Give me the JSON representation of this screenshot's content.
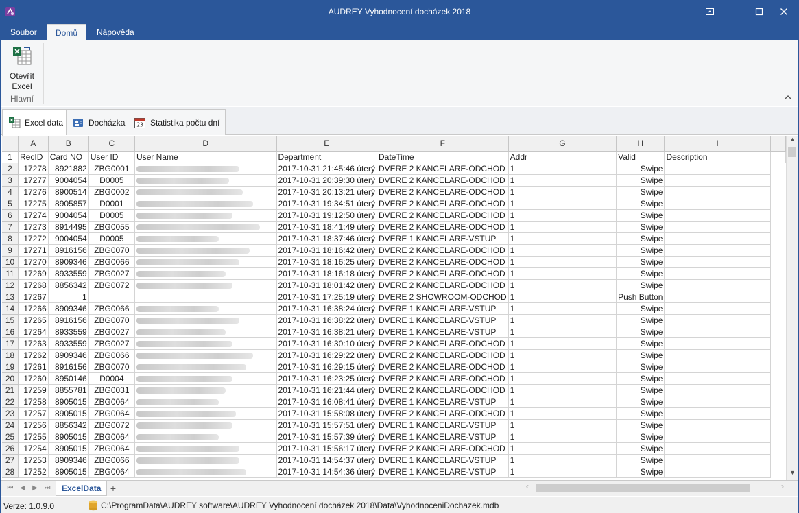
{
  "window": {
    "title": "AUDREY Vyhodnocení docházek 2018"
  },
  "ribbon": {
    "tabs": [
      "Soubor",
      "Domů",
      "Nápověda"
    ],
    "open_excel_label_1": "Otevřít",
    "open_excel_label_2": "Excel",
    "group_label": "Hlavní"
  },
  "doc_tabs": [
    "Excel data",
    "Docházka",
    "Statistika počtu dní"
  ],
  "grid": {
    "column_letters": [
      "A",
      "B",
      "C",
      "D",
      "E",
      "F",
      "G",
      "H",
      "I"
    ],
    "headers": [
      "RecID",
      "Card NO",
      "User ID",
      "User Name",
      "Department",
      "DateTime",
      "Addr",
      "Valid",
      "Description"
    ],
    "rows": [
      [
        "2",
        "17278",
        "8921882",
        "ZBG0001",
        "",
        "2017-10-31 21:45:46 úterý",
        "DVERE 2 KANCELARE-ODCHOD",
        "1",
        "Swipe"
      ],
      [
        "3",
        "17277",
        "9004054",
        "D0005",
        "",
        "2017-10-31 20:39:30 úterý",
        "DVERE 2 KANCELARE-ODCHOD",
        "1",
        "Swipe"
      ],
      [
        "4",
        "17276",
        "8900514",
        "ZBG0002",
        "",
        "2017-10-31 20:13:21 úterý",
        "DVERE 2 KANCELARE-ODCHOD",
        "1",
        "Swipe"
      ],
      [
        "5",
        "17275",
        "8905857",
        "D0001",
        "",
        "2017-10-31 19:34:51 úterý",
        "DVERE 2 KANCELARE-ODCHOD",
        "1",
        "Swipe"
      ],
      [
        "6",
        "17274",
        "9004054",
        "D0005",
        "",
        "2017-10-31 19:12:50 úterý",
        "DVERE 2 KANCELARE-ODCHOD",
        "1",
        "Swipe"
      ],
      [
        "7",
        "17273",
        "8914495",
        "ZBG0055",
        "",
        "2017-10-31 18:41:49 úterý",
        "DVERE 2 KANCELARE-ODCHOD",
        "1",
        "Swipe"
      ],
      [
        "8",
        "17272",
        "9004054",
        "D0005",
        "",
        "2017-10-31 18:37:46 úterý",
        "DVERE 1 KANCELARE-VSTUP",
        "1",
        "Swipe"
      ],
      [
        "9",
        "17271",
        "8916156",
        "ZBG0070",
        "",
        "2017-10-31 18:16:42 úterý",
        "DVERE 2 KANCELARE-ODCHOD",
        "1",
        "Swipe"
      ],
      [
        "10",
        "17270",
        "8909346",
        "ZBG0066",
        "",
        "2017-10-31 18:16:25 úterý",
        "DVERE 2 KANCELARE-ODCHOD",
        "1",
        "Swipe"
      ],
      [
        "11",
        "17269",
        "8933559",
        "ZBG0027",
        "",
        "2017-10-31 18:16:18 úterý",
        "DVERE 2 KANCELARE-ODCHOD",
        "1",
        "Swipe"
      ],
      [
        "12",
        "17268",
        "8856342",
        "ZBG0072",
        "",
        "2017-10-31 18:01:42 úterý",
        "DVERE 2 KANCELARE-ODCHOD",
        "1",
        "Swipe"
      ],
      [
        "13",
        "17267",
        "1",
        "",
        "",
        "2017-10-31 17:25:19 úterý",
        "DVERE 2 SHOWROOM-ODCHOD",
        "1",
        "Push Button"
      ],
      [
        "14",
        "17266",
        "8909346",
        "ZBG0066",
        "",
        "2017-10-31 16:38:24 úterý",
        "DVERE 1 KANCELARE-VSTUP",
        "1",
        "Swipe"
      ],
      [
        "15",
        "17265",
        "8916156",
        "ZBG0070",
        "",
        "2017-10-31 16:38:22 úterý",
        "DVERE 1 KANCELARE-VSTUP",
        "1",
        "Swipe"
      ],
      [
        "16",
        "17264",
        "8933559",
        "ZBG0027",
        "",
        "2017-10-31 16:38:21 úterý",
        "DVERE 1 KANCELARE-VSTUP",
        "1",
        "Swipe"
      ],
      [
        "17",
        "17263",
        "8933559",
        "ZBG0027",
        "",
        "2017-10-31 16:30:10 úterý",
        "DVERE 2 KANCELARE-ODCHOD",
        "1",
        "Swipe"
      ],
      [
        "18",
        "17262",
        "8909346",
        "ZBG0066",
        "",
        "2017-10-31 16:29:22 úterý",
        "DVERE 2 KANCELARE-ODCHOD",
        "1",
        "Swipe"
      ],
      [
        "19",
        "17261",
        "8916156",
        "ZBG0070",
        "",
        "2017-10-31 16:29:15 úterý",
        "DVERE 2 KANCELARE-ODCHOD",
        "1",
        "Swipe"
      ],
      [
        "20",
        "17260",
        "8950146",
        "D0004",
        "",
        "2017-10-31 16:23:25 úterý",
        "DVERE 2 KANCELARE-ODCHOD",
        "1",
        "Swipe"
      ],
      [
        "21",
        "17259",
        "8855781",
        "ZBG0031",
        "",
        "2017-10-31 16:21:44 úterý",
        "DVERE 2 KANCELARE-ODCHOD",
        "1",
        "Swipe"
      ],
      [
        "22",
        "17258",
        "8905015",
        "ZBG0064",
        "",
        "2017-10-31 16:08:41 úterý",
        "DVERE 1 KANCELARE-VSTUP",
        "1",
        "Swipe"
      ],
      [
        "23",
        "17257",
        "8905015",
        "ZBG0064",
        "",
        "2017-10-31 15:58:08 úterý",
        "DVERE 2 KANCELARE-ODCHOD",
        "1",
        "Swipe"
      ],
      [
        "24",
        "17256",
        "8856342",
        "ZBG0072",
        "",
        "2017-10-31 15:57:51 úterý",
        "DVERE 1 KANCELARE-VSTUP",
        "1",
        "Swipe"
      ],
      [
        "25",
        "17255",
        "8905015",
        "ZBG0064",
        "",
        "2017-10-31 15:57:39 úterý",
        "DVERE 1 KANCELARE-VSTUP",
        "1",
        "Swipe"
      ],
      [
        "26",
        "17254",
        "8905015",
        "ZBG0064",
        "",
        "2017-10-31 15:56:17 úterý",
        "DVERE 2 KANCELARE-ODCHOD",
        "1",
        "Swipe"
      ],
      [
        "27",
        "17253",
        "8909346",
        "ZBG0066",
        "",
        "2017-10-31 14:54:37 úterý",
        "DVERE 1 KANCELARE-VSTUP",
        "1",
        "Swipe"
      ],
      [
        "28",
        "17252",
        "8905015",
        "ZBG0064",
        "",
        "2017-10-31 14:54:36 úterý",
        "DVERE 1 KANCELARE-VSTUP",
        "1",
        "Swipe"
      ]
    ],
    "blurred_name_widths": [
      150,
      135,
      155,
      170,
      140,
      180,
      120,
      165,
      150,
      130,
      140,
      0,
      120,
      150,
      130,
      140,
      170,
      160,
      140,
      130,
      120,
      145,
      140,
      120,
      150,
      150,
      160
    ]
  },
  "sheet_tab": "ExcelData",
  "status": {
    "version": "Verze: 1.0.9.0",
    "db_path": "C:\\ProgramData\\AUDREY software\\AUDREY Vyhodnocení docházek 2018\\Data\\VyhodnoceniDochazek.mdb"
  },
  "colors": {
    "accent": "#2b579a",
    "tab_active_text": "#2b579a"
  },
  "icons": [
    "app-icon",
    "excel-open-icon",
    "excel-data-icon",
    "attendance-icon",
    "calendar-icon",
    "database-icon"
  ]
}
